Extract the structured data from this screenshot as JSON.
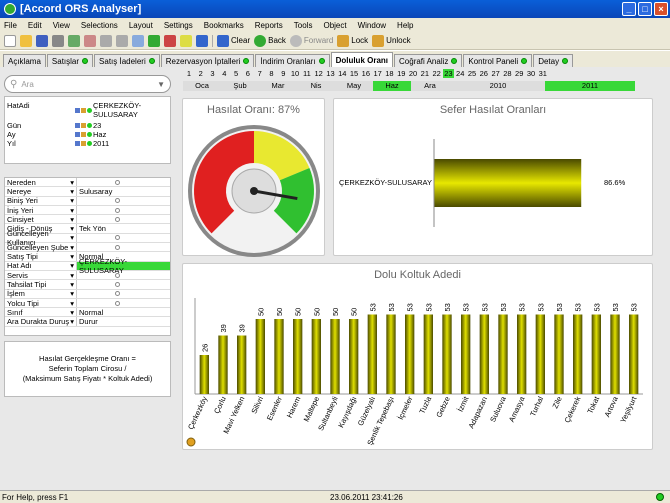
{
  "window": {
    "title": "[Accord ORS Analyser]"
  },
  "menu": [
    "File",
    "Edit",
    "View",
    "Selections",
    "Layout",
    "Settings",
    "Bookmarks",
    "Reports",
    "Tools",
    "Object",
    "Window",
    "Help"
  ],
  "toolbar": {
    "clear": "Clear",
    "back": "Back",
    "forward": "Forward",
    "lock": "Lock",
    "unlock": "Unlock"
  },
  "tabs": [
    {
      "label": "Açıklama",
      "dot": false
    },
    {
      "label": "Satışlar",
      "dot": true
    },
    {
      "label": "Satış İadeleri",
      "dot": true
    },
    {
      "label": "Rezervasyon İptalleri",
      "dot": true
    },
    {
      "label": "İndirim Oranları",
      "dot": true
    },
    {
      "label": "Doluluk Oranı",
      "dot": false,
      "active": true
    },
    {
      "label": "Coğrafi Analiz",
      "dot": true
    },
    {
      "label": "Kontrol Paneli",
      "dot": true
    },
    {
      "label": "Detay",
      "dot": true
    }
  ],
  "search": {
    "placeholder": "Ara"
  },
  "current_selections": [
    {
      "field": "HatAdi",
      "value": "ÇERKEZKÖY-SULUSARAY"
    },
    {
      "field": "Gün",
      "value": "23"
    },
    {
      "field": "Ay",
      "value": "Haz"
    },
    {
      "field": "Yıl",
      "value": "2011"
    }
  ],
  "list_fields": [
    {
      "f": "Nereden",
      "v": "",
      "circle": true
    },
    {
      "f": "Nereye",
      "v": "Sulusaray"
    },
    {
      "f": "Biniş Yeri",
      "v": "",
      "circle": true
    },
    {
      "f": "İniş Yeri",
      "v": "",
      "circle": true
    },
    {
      "f": "Cinsiyet",
      "v": "",
      "circle": true
    },
    {
      "f": "Gidiş - Dönüş",
      "v": "Tek Yön"
    },
    {
      "f": "Güncelleyen Kullanıcı",
      "v": "",
      "circle": true
    },
    {
      "f": "Güncelleyen Şube",
      "v": "",
      "circle": true
    },
    {
      "f": "Satış Tipi",
      "v": "Normal"
    },
    {
      "f": "Hat Adı",
      "v": "ÇERKEZKÖY-SULUSARAY",
      "hl": true
    },
    {
      "f": "Servis",
      "v": "",
      "circle": true
    },
    {
      "f": "Tahsilat Tipi",
      "v": "",
      "circle": true
    },
    {
      "f": "İşlem",
      "v": "",
      "circle": true
    },
    {
      "f": "Yolcu Tipi",
      "v": "",
      "circle": true
    },
    {
      "f": "Sınıf",
      "v": "Normal"
    },
    {
      "f": "Ara Durakta Duruş",
      "v": "Durur"
    }
  ],
  "note": {
    "l1": "Hasılat Gerçekleşme Oranı =",
    "l2": "Seferin Toplam Cirosu /",
    "l3": "(Maksimum Satış Fiyatı * Koltuk Adedi)"
  },
  "days": [
    "1",
    "2",
    "3",
    "4",
    "5",
    "6",
    "7",
    "8",
    "9",
    "10",
    "11",
    "12",
    "13",
    "14",
    "15",
    "16",
    "17",
    "18",
    "19",
    "20",
    "21",
    "22",
    "23",
    "24",
    "25",
    "26",
    "27",
    "28",
    "29",
    "30",
    "31"
  ],
  "selected_day": "23",
  "months": [
    "Oca",
    "Şub",
    "Mar",
    "Nis",
    "May",
    "Haz",
    "Ara"
  ],
  "selected_month": "Haz",
  "years": [
    "2010",
    "2011"
  ],
  "selected_year": "2011",
  "gauge": {
    "title": "Hasılat Oranı: 87%",
    "value": 87
  },
  "sefer": {
    "title": "Sefer Hasılat Oranları",
    "label": "ÇERKEZKÖY-SULUSARAY",
    "value_label": "86.6%",
    "value": 86.6
  },
  "chart_data": {
    "type": "bar",
    "title": "Dolu Koltuk Adedi",
    "categories": [
      "Çerkezköy",
      "Çorlu",
      "Mavi Yelken",
      "Silivri",
      "Esenler",
      "Harem",
      "Maltepe",
      "Sultanbeyli",
      "Kayışdağı",
      "Güzelyalı",
      "Şenlik Tepebaşı",
      "İçmeler",
      "Tuzla",
      "Gebze",
      "İzmit",
      "Adapazarı",
      "Suluova",
      "Amasya",
      "Turhal",
      "Zile",
      "Çekerek",
      "Tokat",
      "Artova",
      "Yeşilyurt"
    ],
    "values": [
      26,
      39,
      39,
      50,
      50,
      50,
      50,
      50,
      50,
      53,
      53,
      53,
      53,
      53,
      53,
      53,
      53,
      53,
      53,
      53,
      53,
      53,
      53,
      53
    ],
    "ylim": [
      0,
      60
    ]
  },
  "status": {
    "help": "For Help, press F1",
    "time": "23.06.2011 23:41:26"
  },
  "colors": {
    "accent": "#38d838",
    "bar": "#b8b800",
    "gauge_red": "#e02020",
    "gauge_yellow": "#e8e830",
    "gauge_green": "#30c030"
  }
}
